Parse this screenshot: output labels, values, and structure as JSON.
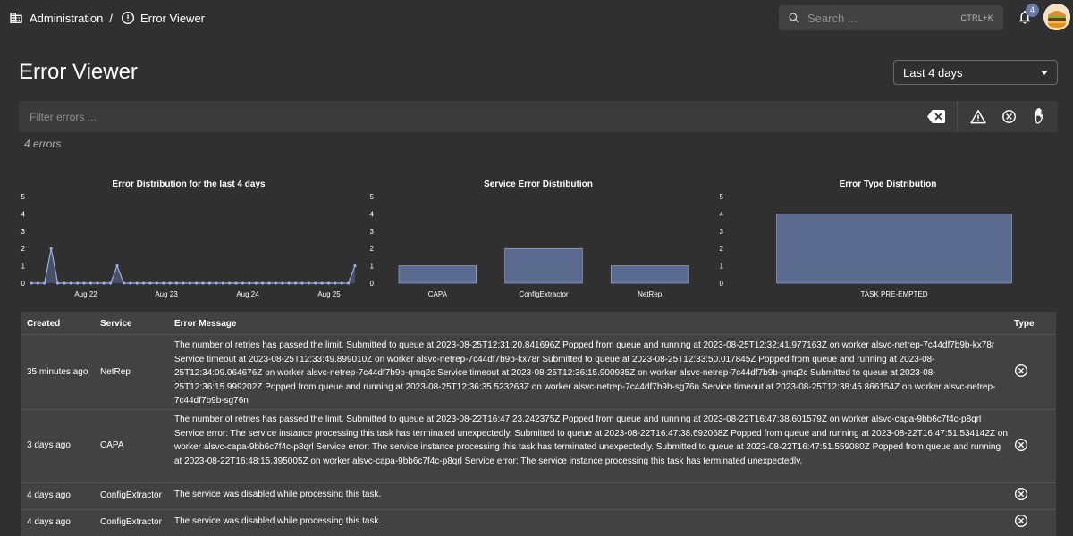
{
  "breadcrumb": {
    "section": "Administration",
    "separator": "/",
    "page": "Error Viewer"
  },
  "search": {
    "placeholder": "Search ...",
    "shortcut": "CTRL+K"
  },
  "notifications": {
    "count": "4"
  },
  "page": {
    "title": "Error Viewer",
    "range": "Last 4 days"
  },
  "filter": {
    "placeholder": "Filter errors ...",
    "summary": "4 errors"
  },
  "icons": {
    "breadcrumb_section": "domain-icon",
    "breadcrumb_page": "alert-circle-outline-icon",
    "search": "search-icon",
    "notifications": "bell-icon",
    "avatar": "burger-avatar",
    "clear_filter": "backspace-icon",
    "warning_filter": "warning-outline-icon",
    "error_filter": "cancel-circle-icon",
    "terminated_filter": "hand-stop-icon",
    "row_type": "cancel-circle-icon"
  },
  "colors": {
    "bar_fill": "#5b6b8f",
    "bar_stroke": "#aab8d8",
    "line": "#9aaee0",
    "background": "#303030",
    "panel": "#424242"
  },
  "charts": {
    "timeline_title": "Error Distribution for the last 4 days",
    "service_title": "Service Error Distribution",
    "type_title": "Error Type Distribution"
  },
  "chart_data": [
    {
      "type": "area",
      "title": "Error Distribution for the last 4 days",
      "ylim": [
        0,
        5
      ],
      "yticks": [
        "0",
        "1",
        "2",
        "3",
        "4",
        "5"
      ],
      "xtick_labels": [
        "Aug 22",
        "Aug 23",
        "Aug 24",
        "Aug 25"
      ],
      "values": [
        0,
        0,
        0,
        2,
        0,
        0,
        0,
        0,
        0,
        0,
        0,
        0,
        0,
        1,
        0,
        0,
        0,
        0,
        0,
        0,
        0,
        0,
        0,
        0,
        0,
        0,
        0,
        0,
        0,
        0,
        0,
        0,
        0,
        0,
        0,
        0,
        0,
        0,
        0,
        0,
        0,
        0,
        0,
        0,
        0,
        0,
        0,
        0,
        0,
        1
      ]
    },
    {
      "type": "bar",
      "title": "Service Error Distribution",
      "categories": [
        "CAPA",
        "ConfigExtractor",
        "NetRep"
      ],
      "values": [
        1,
        2,
        1
      ],
      "ylim": [
        0,
        5
      ],
      "yticks": [
        "0",
        "1",
        "2",
        "3",
        "4",
        "5"
      ]
    },
    {
      "type": "bar",
      "title": "Error Type Distribution",
      "categories": [
        "TASK PRE-EMPTED"
      ],
      "values": [
        4
      ],
      "ylim": [
        0,
        5
      ],
      "yticks": [
        "0",
        "1",
        "2",
        "3",
        "4",
        "5"
      ]
    }
  ],
  "table": {
    "headers": {
      "created": "Created",
      "service": "Service",
      "message": "Error Message",
      "type": "Type"
    },
    "rows": [
      {
        "created": "35 minutes ago",
        "service": "NetRep",
        "type_icon": "cancel-circle-icon",
        "message": "The number of retries has passed the limit. Submitted to queue at 2023-08-25T12:31:20.841696Z Popped from queue and running at 2023-08-25T12:32:41.977163Z on worker alsvc-netrep-7c44df7b9b-kx78r Service timeout at 2023-08-25T12:33:49.899010Z on worker alsvc-netrep-7c44df7b9b-kx78r Submitted to queue at 2023-08-25T12:33:50.017845Z Popped from queue and running at 2023-08-25T12:34:09.064676Z on worker alsvc-netrep-7c44df7b9b-qmq2c Service timeout at 2023-08-25T12:36:15.900935Z on worker alsvc-netrep-7c44df7b9b-qmq2c Submitted to queue at 2023-08-25T12:36:15.999202Z Popped from queue and running at 2023-08-25T12:36:35.523263Z on worker alsvc-netrep-7c44df7b9b-sg76n Service timeout at 2023-08-25T12:38:45.866154Z on worker alsvc-netrep-7c44df7b9b-sg76n"
      },
      {
        "created": "3 days ago",
        "service": "CAPA",
        "type_icon": "cancel-circle-icon",
        "message": "The number of retries has passed the limit. Submitted to queue at 2023-08-22T16:47:23.242375Z Popped from queue and running at 2023-08-22T16:47:38.601579Z on worker alsvc-capa-9bb6c7f4c-p8qrl Service error: The service instance processing this task has terminated unexpectedly. Submitted to queue at 2023-08-22T16:47:38.692068Z Popped from queue and running at 2023-08-22T16:47:51.534142Z on worker alsvc-capa-9bb6c7f4c-p8qrl Service error: The service instance processing this task has terminated unexpectedly. Submitted to queue at 2023-08-22T16:47:51.559080Z Popped from queue and running at 2023-08-22T16:48:15.395005Z on worker alsvc-capa-9bb6c7f4c-p8qrl Service error: The service instance processing this task has terminated unexpectedly."
      },
      {
        "created": "4 days ago",
        "service": "ConfigExtractor",
        "type_icon": "cancel-circle-icon",
        "message": "The service was disabled while processing this task."
      },
      {
        "created": "4 days ago",
        "service": "ConfigExtractor",
        "type_icon": "cancel-circle-icon",
        "message": "The service was disabled while processing this task."
      }
    ]
  }
}
